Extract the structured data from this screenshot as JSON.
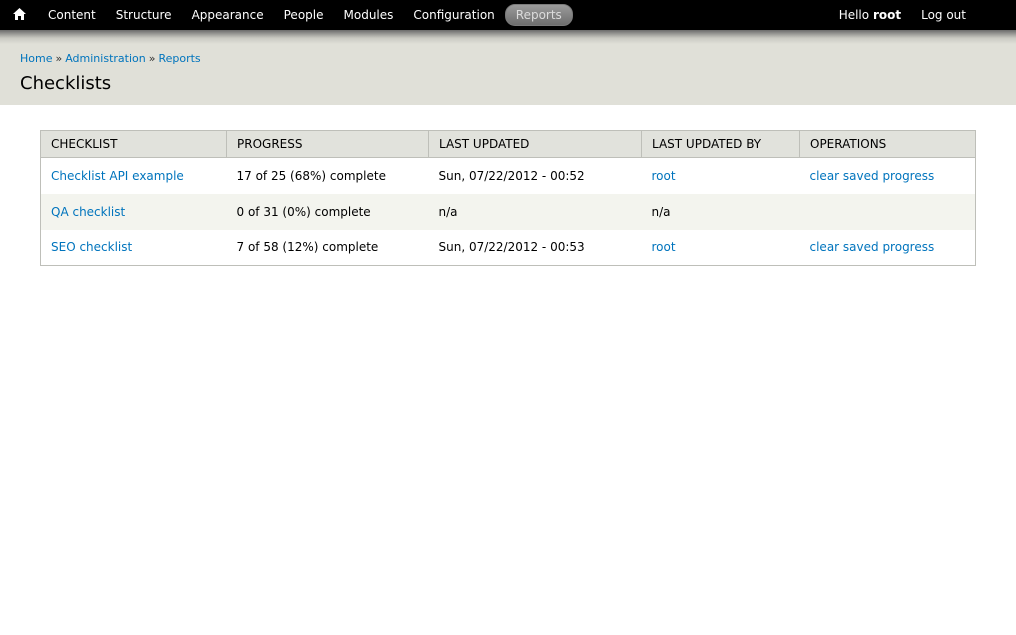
{
  "toolbar": {
    "home_icon": "home-icon",
    "items": [
      {
        "label": "Content"
      },
      {
        "label": "Structure"
      },
      {
        "label": "Appearance"
      },
      {
        "label": "People"
      },
      {
        "label": "Modules"
      },
      {
        "label": "Configuration"
      },
      {
        "label": "Reports",
        "active": true
      }
    ],
    "hello_prefix": "Hello",
    "username": "root",
    "logout_label": "Log out"
  },
  "breadcrumb": {
    "items": [
      "Home",
      "Administration",
      "Reports"
    ],
    "separator": "»"
  },
  "page_title": "Checklists",
  "table": {
    "headers": [
      "CHECKLIST",
      "PROGRESS",
      "LAST UPDATED",
      "LAST UPDATED BY",
      "OPERATIONS"
    ],
    "rows": [
      {
        "checklist": "Checklist API example",
        "progress": "17 of 25 (68%) complete",
        "last_updated": "Sun, 07/22/2012 - 00:52",
        "last_updated_by": "root",
        "operations": "clear saved progress"
      },
      {
        "checklist": "QA checklist",
        "progress": "0 of 31 (0%) complete",
        "last_updated": "n/a",
        "last_updated_by": "n/a",
        "operations": ""
      },
      {
        "checklist": "SEO checklist",
        "progress": "7 of 58 (12%) complete",
        "last_updated": "Sun, 07/22/2012 - 00:53",
        "last_updated_by": "root",
        "operations": "clear saved progress"
      }
    ]
  },
  "colors": {
    "toolbar_bg": "#000000",
    "link": "#0074bd",
    "header_bg": "#e1e2dc",
    "row_even_bg": "#f3f4ee"
  }
}
